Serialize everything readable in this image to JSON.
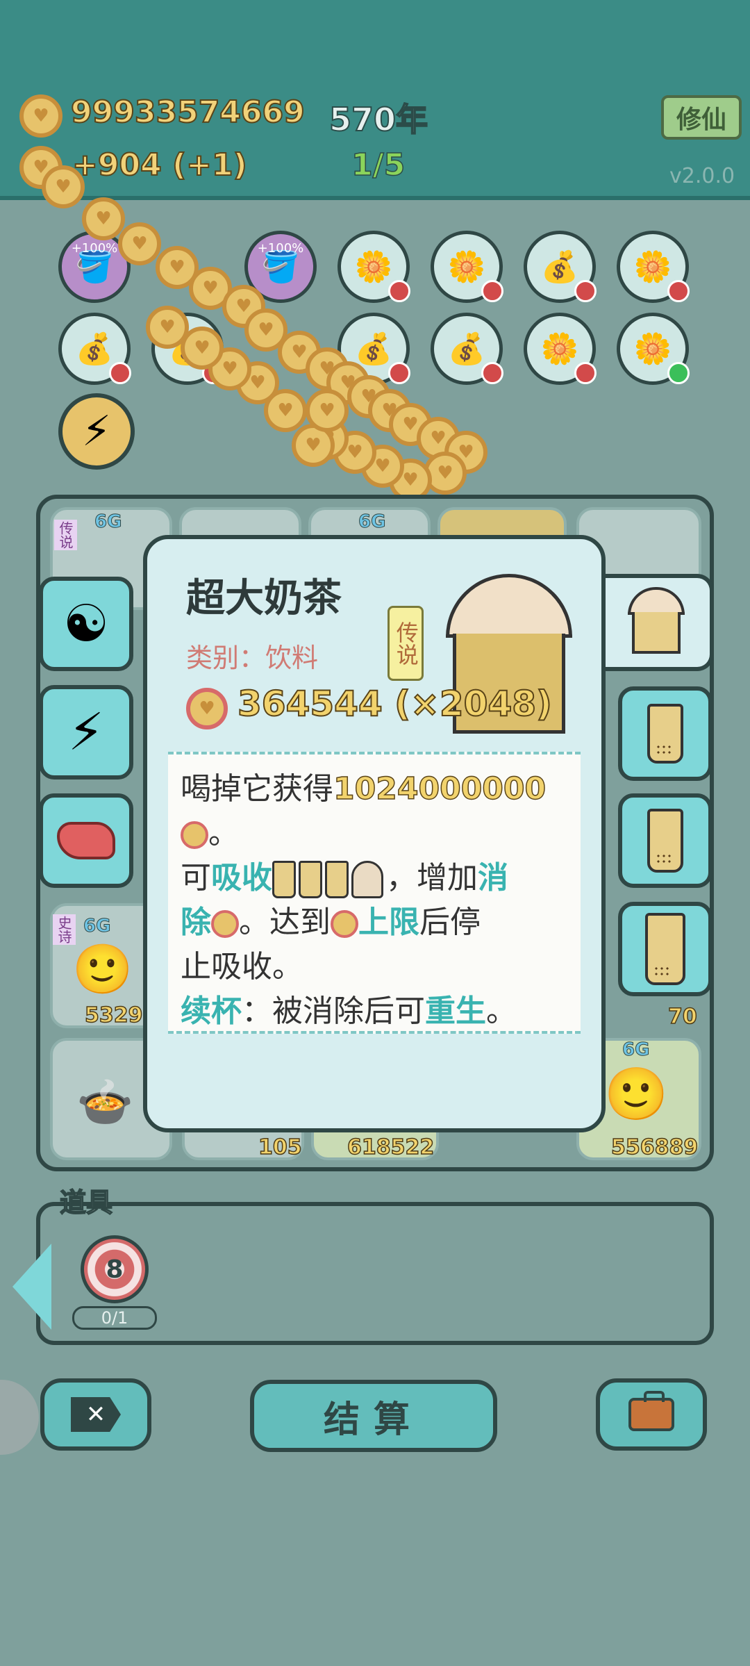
{
  "header": {
    "coins": "99933574669",
    "years": "570年",
    "income": "+904 (+1)",
    "progress": "1/5",
    "cultivate_label": "修仙",
    "version": "v2.0.0"
  },
  "slots": {
    "bonus_label_1": "+100%",
    "bonus_label_2": "+100%"
  },
  "board": {
    "cell_values": [
      "5329",
      "105",
      "618522",
      "556889",
      "70"
    ],
    "badges": [
      "6G",
      "6G",
      "6G",
      "6G",
      "6G"
    ],
    "small_tags": [
      "传说",
      "史诗"
    ]
  },
  "popup": {
    "title": "超大奶茶",
    "category": "类别：饮料",
    "rarity": "传说",
    "price": "364544 (×2048)",
    "desc_line1_prefix": "喝掉它获得",
    "desc_line1_value": "1024000000",
    "desc_line2_suffix": "。",
    "desc_line3_prefix": "可",
    "desc_line3_absorb": "吸收",
    "desc_line3_mid": "，增加",
    "desc_line3_eliminate": "消",
    "desc_line4_eliminate": "除",
    "desc_line4_mid": "。达到",
    "desc_line4_limit": "上限",
    "desc_line4_suffix": "后停",
    "desc_line5": "止吸收。",
    "desc_line6_refill": "续杯",
    "desc_line6_mid": "：被消除后可",
    "desc_line6_rebirth": "重生",
    "desc_line6_end": "。"
  },
  "props": {
    "label": "道具",
    "target_count": "8",
    "target_progress": "0/1"
  },
  "bottom": {
    "settle_label": "结算"
  },
  "colors": {
    "header_bg": "#3b8c86",
    "coin_gold": "#e7c36b",
    "accent_teal": "#39b3b0",
    "highlight_yellow": "#f2d36d",
    "category_pink": "#d07b74"
  }
}
